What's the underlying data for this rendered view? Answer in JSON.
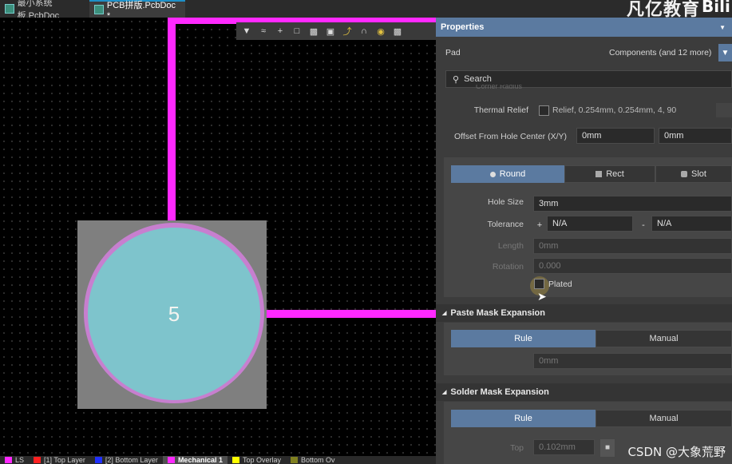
{
  "tabs": [
    {
      "label": "最小系统板.PcbDoc"
    },
    {
      "label": "PCB拼版.PcbDoc *"
    }
  ],
  "watermark": {
    "text": "凡亿教育",
    "logo": "Bili"
  },
  "canvas": {
    "pad_number": "5",
    "colors": {
      "trace": "#ff29ff",
      "pad": "#7ec4cc",
      "pad_ring": "#c77fcf",
      "pad_square": "#7f7f7f",
      "background": "#000000"
    },
    "toolbar_icons": [
      "filter-icon",
      "route-icon",
      "add-icon",
      "select-rect-icon",
      "chart-icon",
      "component-icon",
      "interactive-route-icon",
      "arc-icon",
      "via-icon",
      "pad-tool-icon"
    ]
  },
  "layers": [
    {
      "label": "LS",
      "color": "#ff29ff"
    },
    {
      "label": "[1] Top Layer",
      "color": "#ff2020"
    },
    {
      "label": "[2] Bottom Layer",
      "color": "#2030ff"
    },
    {
      "label": "Mechanical 1",
      "color": "#ff29ff"
    },
    {
      "label": "Top Overlay",
      "color": "#ffff00"
    },
    {
      "label": "Bottom Ov",
      "color": "#808020"
    }
  ],
  "panel": {
    "title": "Properties",
    "object": "Pad",
    "filter_text": "Components (and 12 more)",
    "search_placeholder": "Search",
    "clipped_label": "Corner Radius",
    "thermal_relief": {
      "label": "Thermal Relief",
      "value": "Relief, 0.254mm, 0.254mm, 4, 90"
    },
    "offset": {
      "label": "Offset From Hole Center (X/Y)",
      "x": "0mm",
      "y": "0mm"
    },
    "hole_shapes": [
      {
        "label": "Round",
        "active": true
      },
      {
        "label": "Rect",
        "active": false
      },
      {
        "label": "Slot",
        "active": false
      }
    ],
    "hole_size": {
      "label": "Hole Size",
      "value": "3mm"
    },
    "tolerance": {
      "label": "Tolerance",
      "plus_sign": "+",
      "minus_sign": "-",
      "plus": "N/A",
      "minus": "N/A"
    },
    "length": {
      "label": "Length",
      "value": "0mm"
    },
    "rotation": {
      "label": "Rotation",
      "value": "0.000"
    },
    "plated": {
      "label": "Plated",
      "checked": false
    },
    "paste_mask": {
      "title": "Paste Mask Expansion",
      "options": [
        "Rule",
        "Manual"
      ],
      "value": "0mm"
    },
    "solder_mask": {
      "title": "Solder Mask Expansion",
      "options": [
        "Rule",
        "Manual"
      ],
      "top_label": "Top",
      "top_value": "0.102mm"
    }
  },
  "csdn_watermark": "CSDN @大象荒野"
}
